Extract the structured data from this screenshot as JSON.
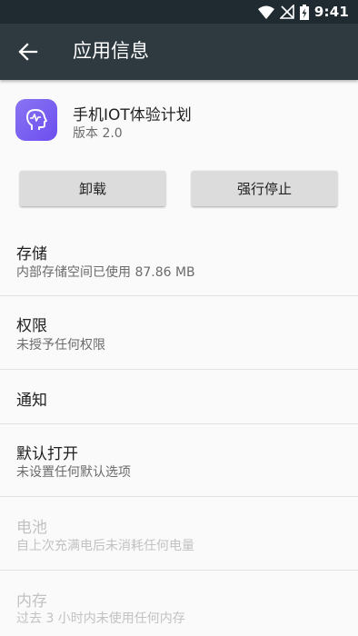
{
  "status_bar": {
    "time": "9:41"
  },
  "app_bar": {
    "title": "应用信息"
  },
  "app": {
    "name": "手机IOT体验计划",
    "version": "版本 2.0"
  },
  "buttons": {
    "uninstall": "卸载",
    "force_stop": "强行停止"
  },
  "settings": {
    "storage": {
      "title": "存储",
      "summary": "内部存储空间已使用 87.86 MB"
    },
    "permissions": {
      "title": "权限",
      "summary": "未授予任何权限"
    },
    "notifications": {
      "title": "通知"
    },
    "default_open": {
      "title": "默认打开",
      "summary": "未设置任何默认选项"
    },
    "battery": {
      "title": "电池",
      "summary": "自上次充满电后未消耗任何电量"
    },
    "memory": {
      "title": "内存",
      "summary": "过去 3 小时内未使用任何内存"
    }
  }
}
